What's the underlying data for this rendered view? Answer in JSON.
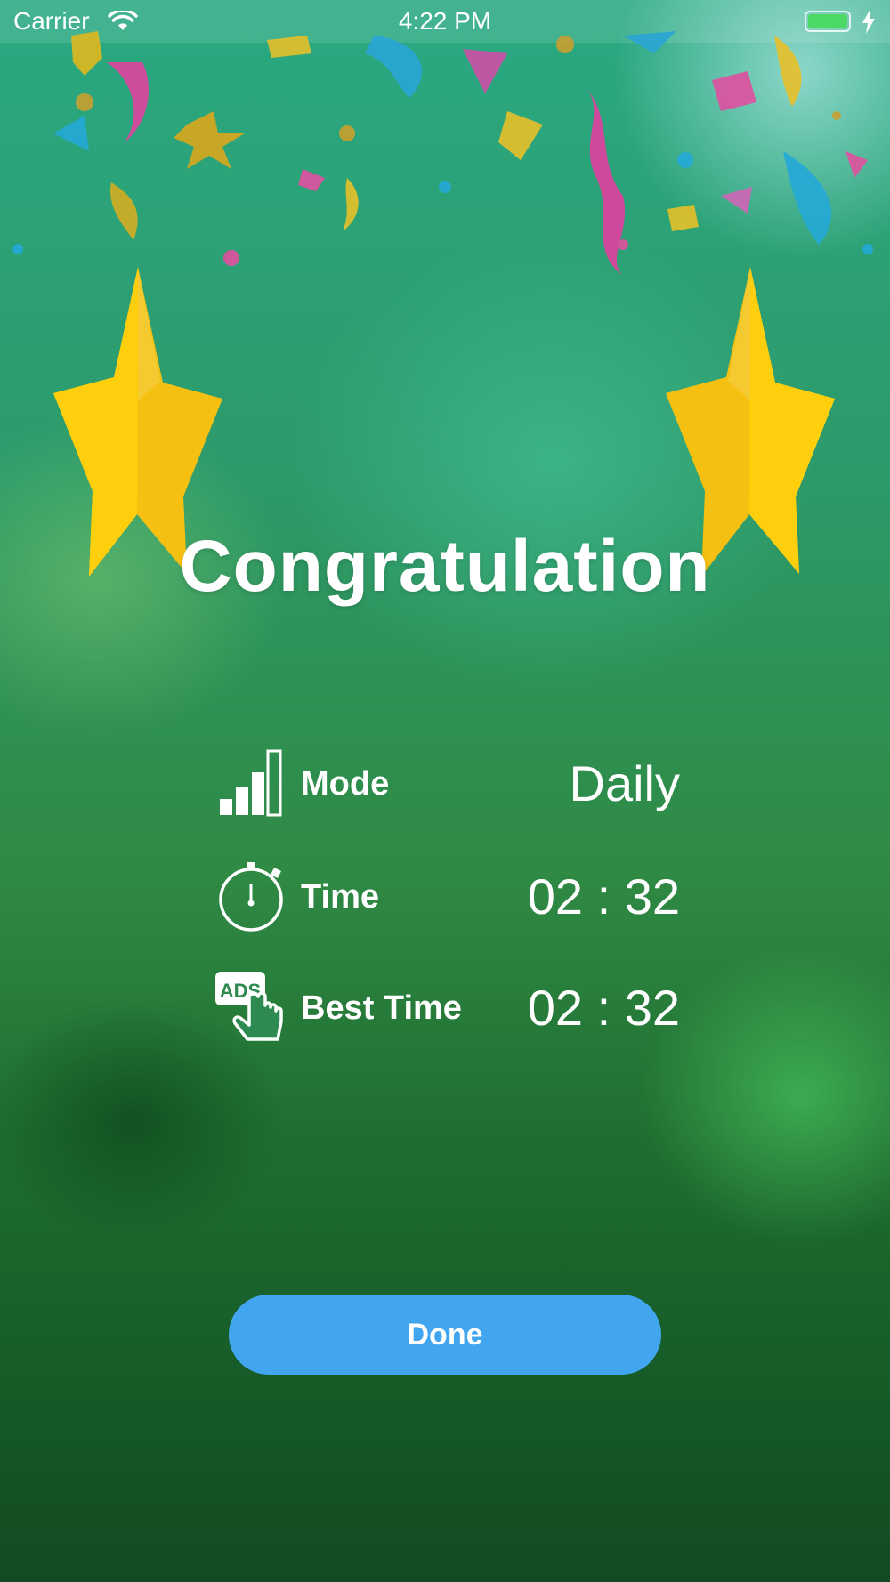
{
  "status_bar": {
    "carrier": "Carrier",
    "time": "4:22 PM",
    "battery_color": "#4cd964"
  },
  "title": "Congratulation",
  "stats": {
    "mode": {
      "icon": "signal-bars-icon",
      "label": "Mode",
      "value": "Daily"
    },
    "time": {
      "icon": "stopwatch-icon",
      "label": "Time",
      "value": "02 : 32"
    },
    "best_time": {
      "icon": "ads-tap-icon",
      "icon_text": "ADS",
      "label": "Best Time",
      "value": "02 : 32"
    }
  },
  "done_button": {
    "label": "Done",
    "color": "#42a5f0"
  }
}
